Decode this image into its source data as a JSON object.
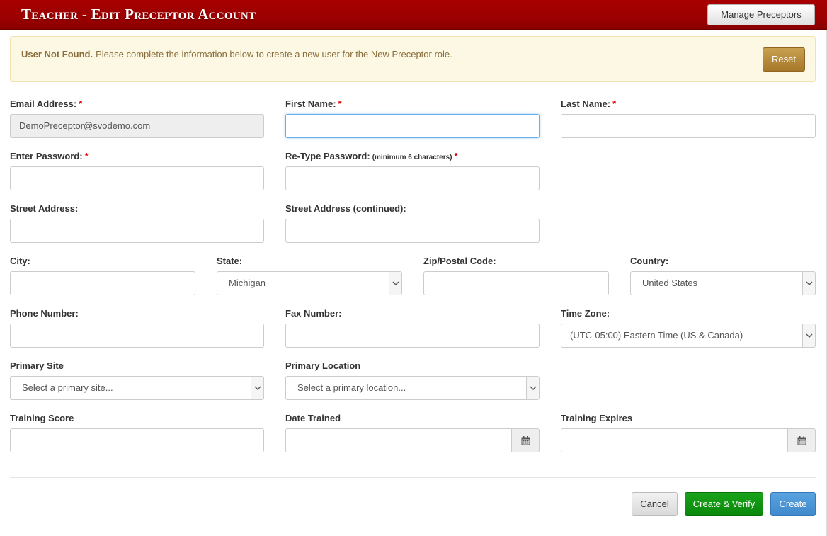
{
  "header": {
    "title": "Teacher - Edit Preceptor Account",
    "manage_button": "Manage Preceptors"
  },
  "alert": {
    "strong": "User Not Found.",
    "message": "Please complete the information below to create a new user for the New Preceptor role.",
    "reset_button": "Reset"
  },
  "form": {
    "email": {
      "label": "Email Address:",
      "value": "DemoPreceptor@svodemo.com"
    },
    "first_name": {
      "label": "First Name:",
      "value": ""
    },
    "last_name": {
      "label": "Last Name:",
      "value": ""
    },
    "password": {
      "label": "Enter Password:",
      "value": ""
    },
    "retype_password": {
      "label": "Re-Type Password:",
      "hint": "(minimum 6 characters)",
      "value": ""
    },
    "street": {
      "label": "Street Address:",
      "value": ""
    },
    "street2": {
      "label": "Street Address (continued):",
      "value": ""
    },
    "city": {
      "label": "City:",
      "value": ""
    },
    "state": {
      "label": "State:",
      "value": "Michigan"
    },
    "zip": {
      "label": "Zip/Postal Code:",
      "value": ""
    },
    "country": {
      "label": "Country:",
      "value": "United States"
    },
    "phone": {
      "label": "Phone Number:",
      "value": ""
    },
    "fax": {
      "label": "Fax Number:",
      "value": ""
    },
    "timezone": {
      "label": "Time Zone:",
      "value": "(UTC-05:00) Eastern Time (US & Canada)"
    },
    "primary_site": {
      "label": "Primary Site",
      "value": "Select a primary site..."
    },
    "primary_location": {
      "label": "Primary Location",
      "value": "Select a primary location..."
    },
    "training_score": {
      "label": "Training Score",
      "value": ""
    },
    "date_trained": {
      "label": "Date Trained",
      "value": ""
    },
    "training_expires": {
      "label": "Training Expires",
      "value": ""
    },
    "required_mark": "*"
  },
  "actions": {
    "cancel": "Cancel",
    "create_verify": "Create & Verify",
    "create": "Create"
  },
  "icons": {
    "select_caret": "chevron-down-icon",
    "date_addon": "calendar-icon"
  },
  "colors": {
    "header": "#a00000",
    "alert_bg": "#fcf8e3",
    "reset": "#b08a3e",
    "verify": "#129612",
    "create": "#4a94d6",
    "required": "#dd0000"
  }
}
